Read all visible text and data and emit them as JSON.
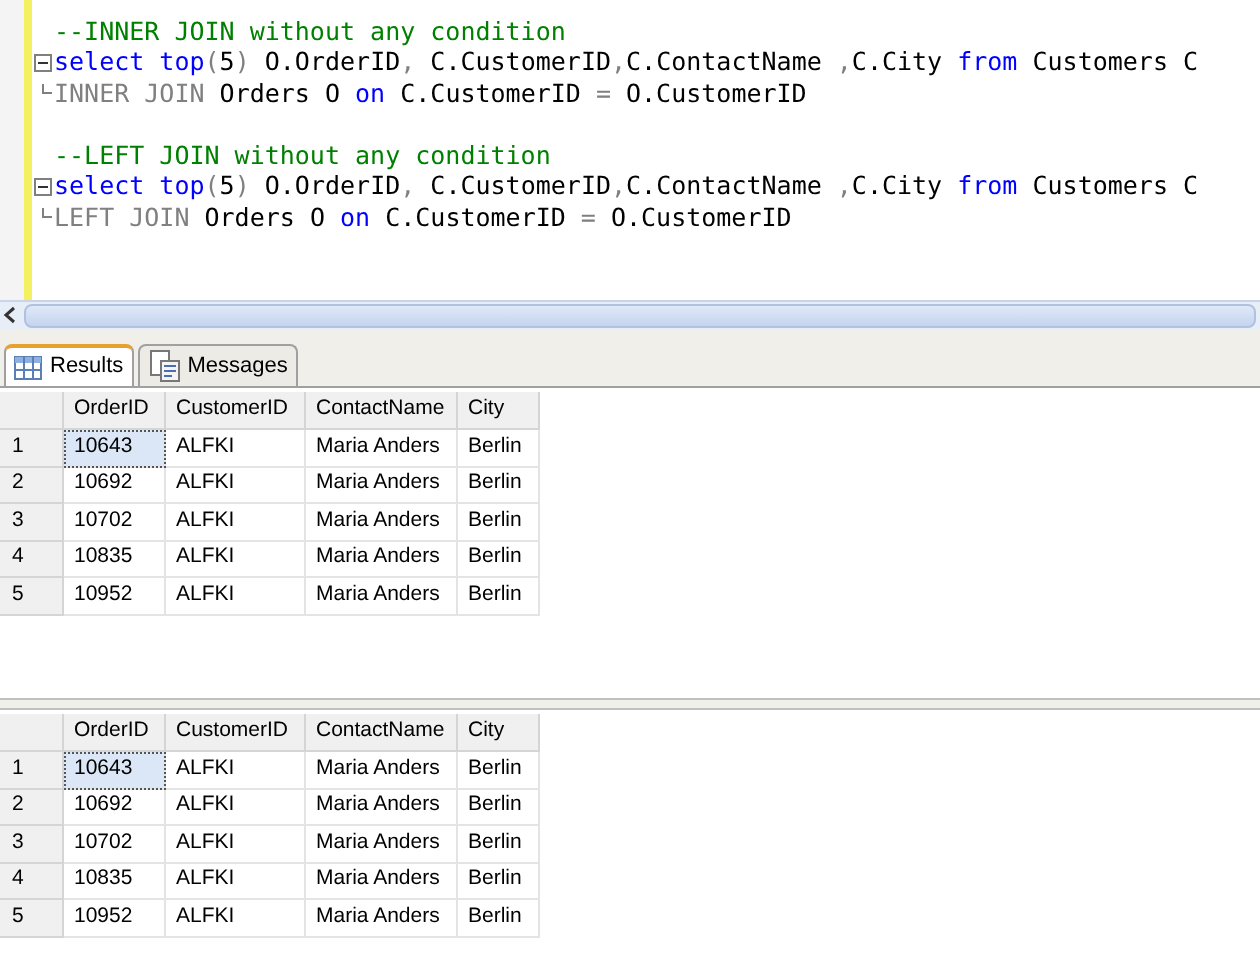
{
  "editor": {
    "lines": [
      {
        "kind": "plain",
        "tokens": [
          {
            "kind": "comment",
            "text": "--INNER JOIN without any condition"
          }
        ]
      },
      {
        "kind": "fold-start",
        "tokens": [
          {
            "kind": "keyword",
            "text": "select"
          },
          {
            "kind": "keyword",
            "text": " top"
          },
          {
            "kind": "gray",
            "text": "("
          },
          {
            "kind": "plain",
            "text": "5"
          },
          {
            "kind": "gray",
            "text": ")"
          },
          {
            "kind": "plain",
            "text": " O.OrderID"
          },
          {
            "kind": "gray",
            "text": ","
          },
          {
            "kind": "plain",
            "text": " C.CustomerID"
          },
          {
            "kind": "gray",
            "text": ","
          },
          {
            "kind": "plain",
            "text": "C.ContactName "
          },
          {
            "kind": "gray",
            "text": ","
          },
          {
            "kind": "plain",
            "text": "C.City "
          },
          {
            "kind": "keyword",
            "text": "from"
          },
          {
            "kind": "plain",
            "text": " Customers C"
          }
        ]
      },
      {
        "kind": "fold-end",
        "tokens": [
          {
            "kind": "gray",
            "text": "INNER JOIN"
          },
          {
            "kind": "plain",
            "text": " Orders O "
          },
          {
            "kind": "keyword",
            "text": "on"
          },
          {
            "kind": "plain",
            "text": " C.CustomerID "
          },
          {
            "kind": "gray",
            "text": "="
          },
          {
            "kind": "plain",
            "text": " O.CustomerID"
          }
        ]
      },
      {
        "kind": "blank"
      },
      {
        "kind": "plain",
        "tokens": [
          {
            "kind": "comment",
            "text": "--LEFT JOIN without any condition"
          }
        ]
      },
      {
        "kind": "fold-start",
        "tokens": [
          {
            "kind": "keyword",
            "text": "select"
          },
          {
            "kind": "keyword",
            "text": " top"
          },
          {
            "kind": "gray",
            "text": "("
          },
          {
            "kind": "plain",
            "text": "5"
          },
          {
            "kind": "gray",
            "text": ")"
          },
          {
            "kind": "plain",
            "text": " O.OrderID"
          },
          {
            "kind": "gray",
            "text": ","
          },
          {
            "kind": "plain",
            "text": " C.CustomerID"
          },
          {
            "kind": "gray",
            "text": ","
          },
          {
            "kind": "plain",
            "text": "C.ContactName "
          },
          {
            "kind": "gray",
            "text": ","
          },
          {
            "kind": "plain",
            "text": "C.City "
          },
          {
            "kind": "keyword",
            "text": "from"
          },
          {
            "kind": "plain",
            "text": " Customers C"
          }
        ]
      },
      {
        "kind": "fold-end",
        "tokens": [
          {
            "kind": "gray",
            "text": "LEFT JOIN"
          },
          {
            "kind": "plain",
            "text": " Orders O "
          },
          {
            "kind": "keyword",
            "text": "on"
          },
          {
            "kind": "plain",
            "text": " C.CustomerID "
          },
          {
            "kind": "gray",
            "text": "="
          },
          {
            "kind": "plain",
            "text": " O.CustomerID"
          }
        ]
      }
    ]
  },
  "tabs": [
    {
      "label": "Results",
      "kind": "grid",
      "selected": true
    },
    {
      "label": "Messages",
      "kind": "messages",
      "selected": false
    }
  ],
  "grids": [
    {
      "columns": [
        "OrderID",
        "CustomerID",
        "ContactName",
        "City"
      ],
      "rows": [
        {
          "number": "1",
          "focused": true,
          "cells": [
            "10643",
            "ALFKI",
            "Maria Anders",
            "Berlin"
          ]
        },
        {
          "number": "2",
          "focused": false,
          "cells": [
            "10692",
            "ALFKI",
            "Maria Anders",
            "Berlin"
          ]
        },
        {
          "number": "3",
          "focused": false,
          "cells": [
            "10702",
            "ALFKI",
            "Maria Anders",
            "Berlin"
          ]
        },
        {
          "number": "4",
          "focused": false,
          "cells": [
            "10835",
            "ALFKI",
            "Maria Anders",
            "Berlin"
          ]
        },
        {
          "number": "5",
          "focused": false,
          "cells": [
            "10952",
            "ALFKI",
            "Maria Anders",
            "Berlin"
          ]
        }
      ]
    },
    {
      "columns": [
        "OrderID",
        "CustomerID",
        "ContactName",
        "City"
      ],
      "rows": [
        {
          "number": "1",
          "focused": true,
          "cells": [
            "10643",
            "ALFKI",
            "Maria Anders",
            "Berlin"
          ]
        },
        {
          "number": "2",
          "focused": false,
          "cells": [
            "10692",
            "ALFKI",
            "Maria Anders",
            "Berlin"
          ]
        },
        {
          "number": "3",
          "focused": false,
          "cells": [
            "10702",
            "ALFKI",
            "Maria Anders",
            "Berlin"
          ]
        },
        {
          "number": "4",
          "focused": false,
          "cells": [
            "10835",
            "ALFKI",
            "Maria Anders",
            "Berlin"
          ]
        },
        {
          "number": "5",
          "focused": false,
          "cells": [
            "10952",
            "ALFKI",
            "Maria Anders",
            "Berlin"
          ]
        }
      ]
    }
  ]
}
